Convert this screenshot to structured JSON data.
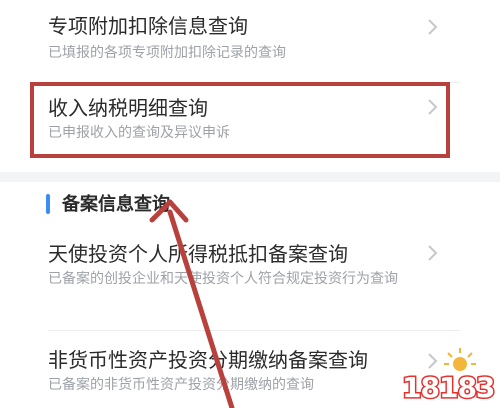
{
  "items": [
    {
      "title": "专项附加扣除信息查询",
      "desc": "已填报的各项专项附加扣除记录的查询"
    },
    {
      "title": "收入纳税明细查询",
      "desc": "已申报收入的查询及异议申诉"
    },
    {
      "title": "天使投资个人所得税抵扣备案查询",
      "desc": "已备案的创投企业和天使投资个人符合规定投资行为查询"
    },
    {
      "title": "非货币性资产投资分期缴纳备案查询",
      "desc": "已备案的非货币性资产投资分期缴纳的查询"
    }
  ],
  "section": {
    "title": "备案信息查询"
  },
  "watermark": {
    "text": "18183"
  },
  "colors": {
    "accent": "#3b8cf5",
    "annotation": "#b8403d",
    "text_primary": "#2b2b2b",
    "text_secondary": "#9ea2a8",
    "background": "#f3f4f6"
  },
  "icons": {
    "row_chevron": "chevron-right-icon"
  }
}
